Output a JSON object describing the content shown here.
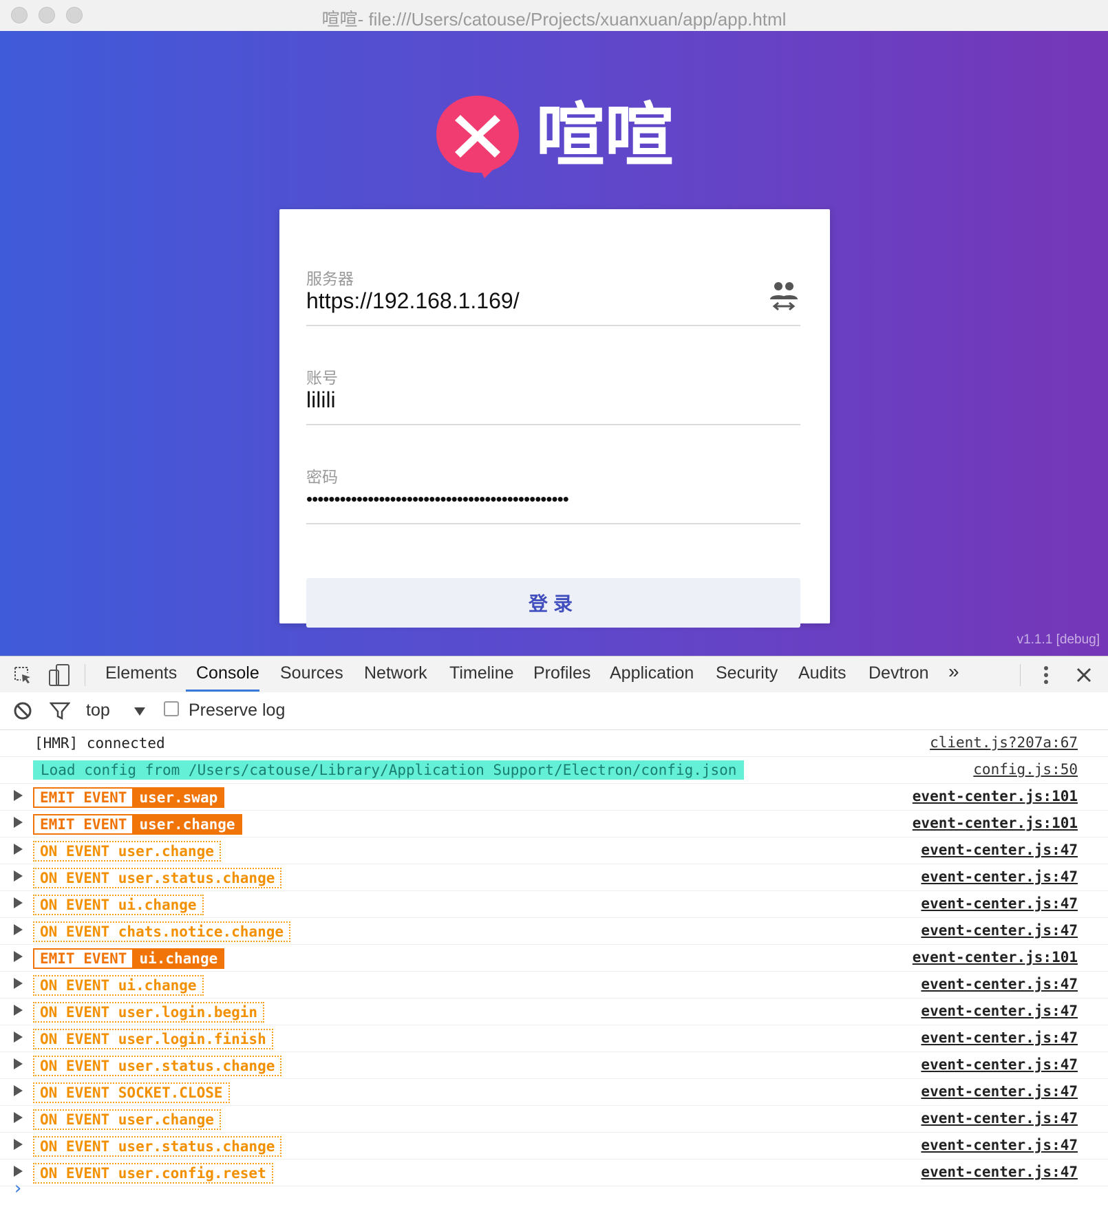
{
  "window": {
    "title": "喧喧- file:///Users/catouse/Projects/xuanxuan/app/app.html"
  },
  "app": {
    "logo_text": "喧喧",
    "form": {
      "server_label": "服务器",
      "server_value": "https://192.168.1.169/",
      "account_label": "账号",
      "account_value": "lilili",
      "password_label": "密码",
      "password_value": "•••••••••••••••••••••••••••••••••••••••••••••••",
      "login_button": "登录"
    },
    "version": "v1.1.1 [debug]",
    "colors": {
      "gradient_start": "#3f5bd9",
      "gradient_end": "#7636b8",
      "logo": "#f03c71",
      "button_text": "#3f4dbd"
    }
  },
  "devtools": {
    "tabs": [
      "Elements",
      "Console",
      "Sources",
      "Network",
      "Timeline",
      "Profiles",
      "Application",
      "Security",
      "Audits",
      "Devtron"
    ],
    "active_tab": "Console",
    "more": "»",
    "toolbar": {
      "context": "top",
      "preserve_log": "Preserve log"
    },
    "console": [
      {
        "type": "plain",
        "text": "[HMR] connected",
        "source": "client.js?207a:67",
        "expand": false
      },
      {
        "type": "info",
        "text": "Load config from /Users/catouse/Library/Application Support/Electron/config.json",
        "source": "config.js:50",
        "expand": false
      },
      {
        "type": "emit",
        "a": "EMIT EVENT",
        "b": "user.swap",
        "source": "event-center.js:101",
        "expand": true
      },
      {
        "type": "emit",
        "a": "EMIT EVENT",
        "b": "user.change",
        "source": "event-center.js:101",
        "expand": true
      },
      {
        "type": "on",
        "text": "ON EVENT user.change",
        "source": "event-center.js:47",
        "expand": true
      },
      {
        "type": "on",
        "text": "ON EVENT user.status.change",
        "source": "event-center.js:47",
        "expand": true
      },
      {
        "type": "on",
        "text": "ON EVENT ui.change",
        "source": "event-center.js:47",
        "expand": true
      },
      {
        "type": "on",
        "text": "ON EVENT chats.notice.change",
        "source": "event-center.js:47",
        "expand": true
      },
      {
        "type": "emit",
        "a": "EMIT EVENT",
        "b": "ui.change",
        "source": "event-center.js:101",
        "expand": true
      },
      {
        "type": "on",
        "text": "ON EVENT ui.change",
        "source": "event-center.js:47",
        "expand": true
      },
      {
        "type": "on",
        "text": "ON EVENT user.login.begin",
        "source": "event-center.js:47",
        "expand": true
      },
      {
        "type": "on",
        "text": "ON EVENT user.login.finish",
        "source": "event-center.js:47",
        "expand": true
      },
      {
        "type": "on",
        "text": "ON EVENT user.status.change",
        "source": "event-center.js:47",
        "expand": true
      },
      {
        "type": "on",
        "text": "ON EVENT SOCKET.CLOSE",
        "source": "event-center.js:47",
        "expand": true
      },
      {
        "type": "on",
        "text": "ON EVENT user.change",
        "source": "event-center.js:47",
        "expand": true
      },
      {
        "type": "on",
        "text": "ON EVENT user.status.change",
        "source": "event-center.js:47",
        "expand": true
      },
      {
        "type": "on",
        "text": "ON EVENT user.config.reset",
        "source": "event-center.js:47",
        "expand": true
      }
    ],
    "prompt": "›"
  }
}
